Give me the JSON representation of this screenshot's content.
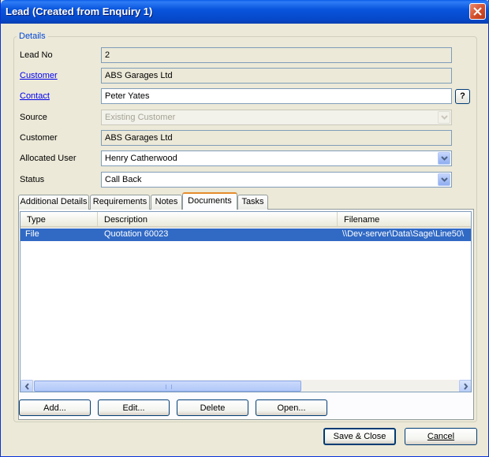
{
  "window": {
    "title": "Lead (Created from Enquiry 1)"
  },
  "details": {
    "legend": "Details",
    "lead_no_label": "Lead No",
    "lead_no_value": "2",
    "customer_link": "Customer",
    "customer_value": "ABS Garages Ltd",
    "contact_link": "Contact",
    "contact_value": "Peter Yates",
    "help_label": "?",
    "source_label": "Source",
    "source_value": "Existing Customer",
    "customer_label": "Customer",
    "customer_name_value": "ABS Garages Ltd",
    "allocated_user_label": "Allocated User",
    "allocated_user_value": "Henry Catherwood",
    "status_label": "Status",
    "status_value": "Call Back"
  },
  "tabs": [
    {
      "label": "Additional Details"
    },
    {
      "label": "Requirements"
    },
    {
      "label": "Notes"
    },
    {
      "label": "Documents",
      "active": true
    },
    {
      "label": "Tasks"
    }
  ],
  "documents": {
    "columns": [
      "Type",
      "Description",
      "Filename"
    ],
    "rows": [
      {
        "type": "File",
        "description": "Quotation 60023",
        "filename": "\\\\Dev-server\\Data\\Sage\\Line50\\"
      }
    ],
    "scrollbar": {
      "thumb_fraction": 0.62
    }
  },
  "buttons": {
    "add": "Add...",
    "edit": "Edit...",
    "delete": "Delete",
    "open": "Open...",
    "save_close": "Save & Close",
    "cancel": "Cancel"
  },
  "colors": {
    "selection": "#316ac5",
    "link": "#0000ee",
    "active_tab_accent": "#e68b2c"
  }
}
